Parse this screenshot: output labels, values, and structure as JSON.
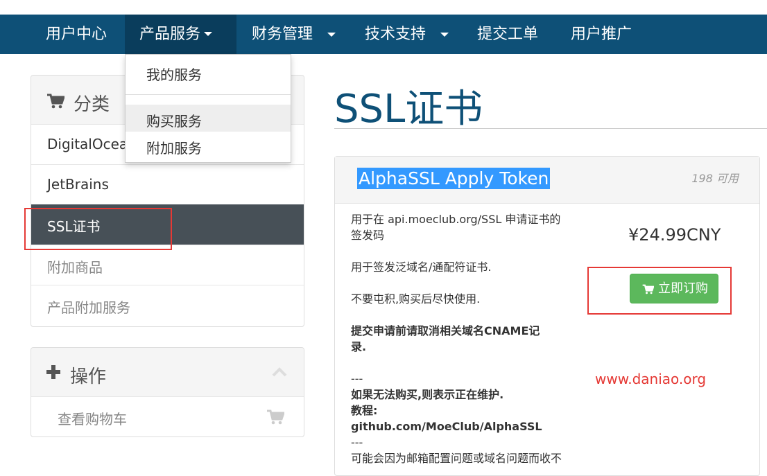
{
  "nav": {
    "items": [
      {
        "label": "用户中心"
      },
      {
        "label": "产品服务"
      },
      {
        "label": "财务管理"
      },
      {
        "label": "技术支持"
      },
      {
        "label": "提交工单"
      },
      {
        "label": "用户推广"
      }
    ]
  },
  "dropdown": {
    "items": [
      {
        "label": "我的服务"
      },
      {
        "label": "购买服务"
      },
      {
        "label": "附加服务"
      }
    ]
  },
  "sidebar": {
    "category_title": "分类",
    "categories": [
      {
        "label": "DigitalOcean"
      },
      {
        "label": "JetBrains"
      },
      {
        "label": "SSL证书"
      },
      {
        "label": "附加商品"
      },
      {
        "label": "产品附加服务"
      }
    ],
    "actions_title": "操作",
    "actions": [
      {
        "label": "查看购物车"
      }
    ]
  },
  "page": {
    "title": "SSL证书"
  },
  "product": {
    "name": "AlphaSSL Apply Token",
    "available": "198 可用",
    "price": "¥24.99CNY",
    "order_label": "立即订购",
    "desc": {
      "line1": "用于在 api.moeclub.org/SSL 申请证书的",
      "line2": "签发码",
      "line3": "用于签发泛域名/通配符证书.",
      "line4": "不要屯积,购买后尽快使用.",
      "line5": "提交申请前请取消相关域名CNAME记",
      "line6": "录.",
      "line7": "---",
      "line8": "如果无法购买,则表示正在维护.",
      "line9": "教程:",
      "line10": "github.com/MoeClub/AlphaSSL",
      "line11": "---",
      "line12": "可能会因为邮箱配置问题或域名问题而收不"
    }
  },
  "watermark": "www.daniao.org",
  "colors": {
    "nav_bg": "#0e5077",
    "accent": "#0e5077",
    "active_sidebar": "#475057",
    "order_button": "#5cb85c",
    "highlight_box": "#e53935"
  }
}
